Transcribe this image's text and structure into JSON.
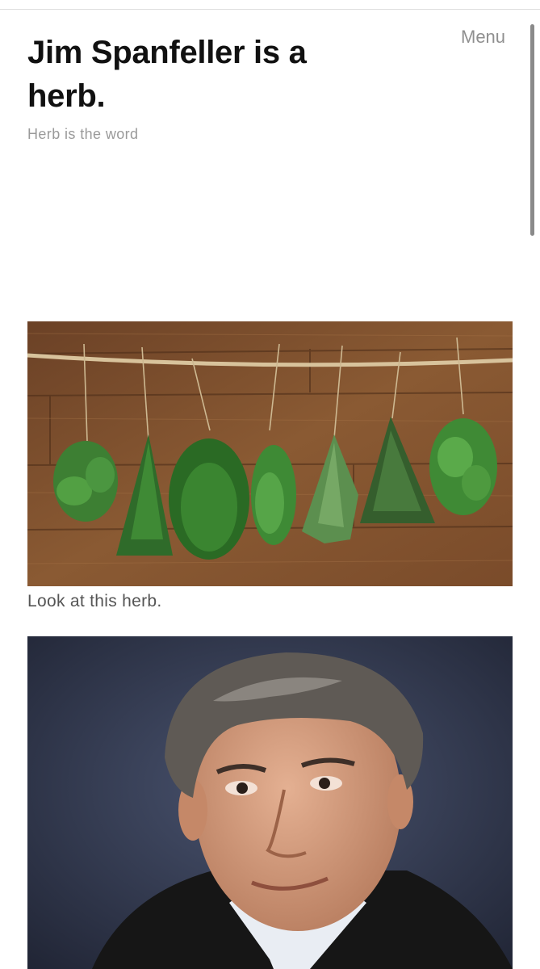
{
  "header": {
    "site_title": "Jim Spanfeller is a herb.",
    "tagline": "Herb is the word",
    "menu_label": "Menu"
  },
  "post": {
    "image_1": {
      "depicts": "herbs-hanging-on-twine"
    },
    "caption_1": "Look at this herb.",
    "image_2": {
      "depicts": "portrait-of-man"
    }
  },
  "colors": {
    "title": "#111111",
    "tagline": "#9a9a9a",
    "menu": "#8f8f8f",
    "caption": "#555555",
    "wood": "#7a4e2d",
    "herb_green": "#3f8a35",
    "portrait_bg": "#2c3346"
  }
}
